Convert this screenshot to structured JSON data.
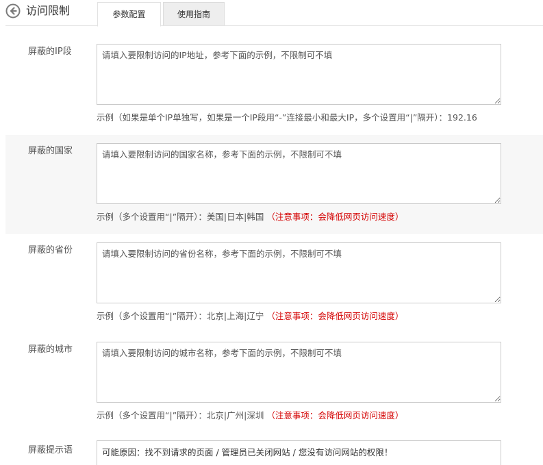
{
  "header": {
    "title": "访问限制",
    "tabs": [
      {
        "label": "参数配置",
        "active": true
      },
      {
        "label": "使用指南",
        "active": false
      }
    ]
  },
  "colors": {
    "warning": "#d40000",
    "border": "#c9c9c9",
    "shade": "#f7f7f7"
  },
  "form": {
    "ip": {
      "label": "屏蔽的IP段",
      "placeholder": "请填入要限制访问的IP地址，参考下面的示例，不限制可不填",
      "value": "",
      "hint": "示例（如果是单个IP单独写，如果是一个IP段用“-”连接最小和最大IP，多个设置用“|”隔开）：192.16"
    },
    "country": {
      "label": "屏蔽的国家",
      "placeholder": "请填入要限制访问的国家名称，参考下面的示例，不限制可不填",
      "value": "",
      "hint": "示例（多个设置用“|”隔开）：美国|日本|韩国",
      "warning": "（注意事项：会降低网页访问速度）"
    },
    "province": {
      "label": "屏蔽的省份",
      "placeholder": "请填入要限制访问的省份名称，参考下面的示例，不限制可不填",
      "value": "",
      "hint": "示例（多个设置用“|”隔开）：北京|上海|辽宁",
      "warning": "（注意事项：会降低网页访问速度）"
    },
    "city": {
      "label": "屏蔽的城市",
      "placeholder": "请填入要限制访问的城市名称，参考下面的示例，不限制可不填",
      "value": "",
      "hint": "示例（多个设置用“|”隔开）：北京|广州|深圳",
      "warning": "（注意事项：会降低网页访问速度）"
    },
    "message": {
      "label": "屏蔽提示语",
      "value": "可能原因：找不到请求的页面 / 管理员已关闭网站 / 您没有访问网站的权限！"
    }
  }
}
